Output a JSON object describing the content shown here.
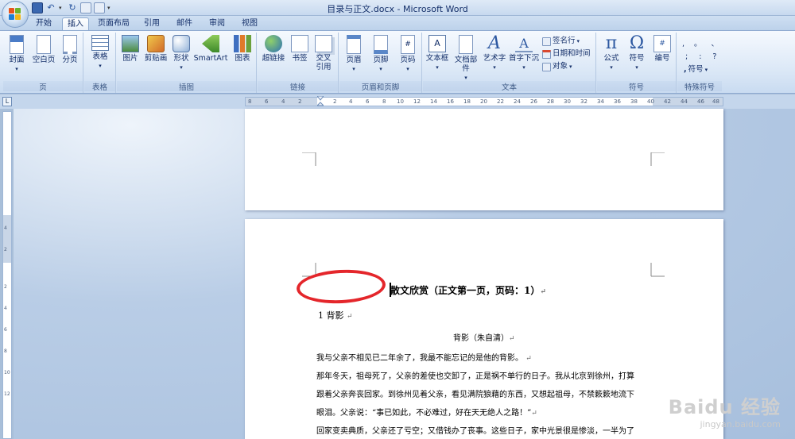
{
  "window": {
    "title": "目录与正文.docx - Microsoft Word"
  },
  "tabs": [
    "开始",
    "插入",
    "页面布局",
    "引用",
    "邮件",
    "审阅",
    "视图"
  ],
  "active_tab": "插入",
  "ribbon": {
    "groups": {
      "pages": {
        "label": "页",
        "buttons": [
          "封面",
          "空白页",
          "分页"
        ]
      },
      "table": {
        "label": "表格",
        "buttons": [
          "表格"
        ]
      },
      "illustrations": {
        "label": "插图",
        "buttons": [
          "图片",
          "剪贴画",
          "形状",
          "SmartArt",
          "图表"
        ]
      },
      "links": {
        "label": "链接",
        "buttons": [
          "超链接",
          "书签",
          "交叉",
          "引用"
        ]
      },
      "header_footer": {
        "label": "页眉和页脚",
        "buttons": [
          "页眉",
          "页脚",
          "页码"
        ]
      },
      "text": {
        "label": "文本",
        "buttons": [
          "文本框",
          "文档部件",
          "艺术字",
          "首字下沉"
        ],
        "small": [
          "签名行",
          "日期和时间",
          "对象"
        ]
      },
      "symbols": {
        "label": "符号",
        "buttons": [
          "公式",
          "符号",
          "编号"
        ]
      },
      "special": {
        "label": "特殊符号",
        "items": [
          ",",
          "。",
          "、",
          ";",
          ":",
          "?",
          "符号"
        ]
      }
    }
  },
  "ruler": {
    "ticks": [
      "8",
      "6",
      "4",
      "2",
      "2",
      "4",
      "6",
      "8",
      "10",
      "12",
      "14",
      "16",
      "18",
      "20",
      "22",
      "24",
      "26",
      "28",
      "30",
      "32",
      "34",
      "36",
      "38",
      "40",
      "42",
      "44",
      "46",
      "48"
    ]
  },
  "vruler": {
    "ticks": [
      "4",
      "2",
      "2",
      "4",
      "6",
      "8",
      "10",
      "12"
    ]
  },
  "document": {
    "heading": "散文欣赏（正文第一页，页码：1）",
    "section": "1   背影",
    "subtitle": "背影（朱自清）",
    "paragraphs": [
      "我与父亲不相见已二年余了，我最不能忘记的是他的背影。",
      "那年冬天，祖母死了，父亲的差使也交卸了，正是祸不单行的日子。我从北京到徐州，打算",
      "跟着父亲奔丧回家。到徐州见着父亲，看见满院狼藉的东西，又想起祖母，不禁簌簌地流下",
      "眼泪。父亲说：“事已如此，不必难过，好在天无绝人之路！”",
      "回家变卖典质，父亲还了亏空；又借钱办了丧事。这些日子，家中光景很是惨淡，一半为了"
    ],
    "return_mark": "↵"
  },
  "watermark": {
    "brand": "Baidu 经验",
    "url": "jingyan.baidu.com"
  },
  "colors": {
    "accent": "#e4262b",
    "ribbon_bg": "#dde9f7",
    "workspace": "#a9bfd9"
  }
}
